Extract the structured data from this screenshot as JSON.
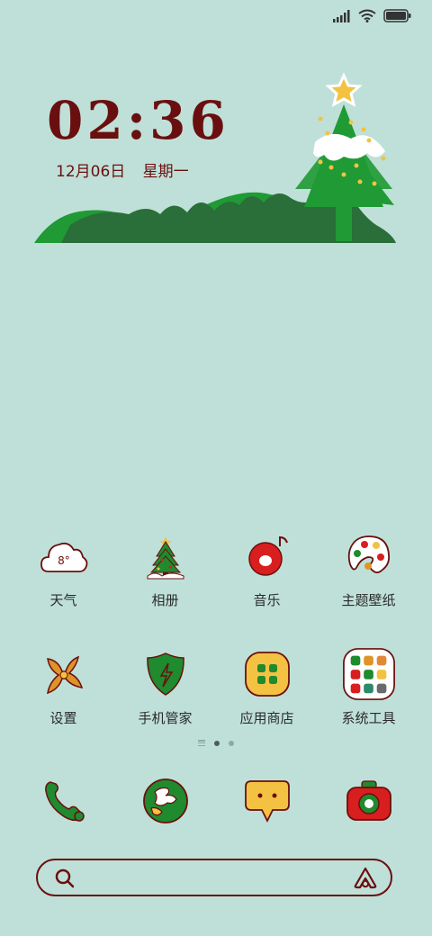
{
  "status_bar": {
    "icons": [
      "signal-icon",
      "wifi-icon",
      "battery-icon"
    ]
  },
  "clock": {
    "time": "02:36",
    "date": "12月06日",
    "weekday": "星期一"
  },
  "apps": [
    {
      "label": "天气",
      "icon": "weather-cloud-icon",
      "temperature": "8°"
    },
    {
      "label": "相册",
      "icon": "christmas-tree-icon"
    },
    {
      "label": "音乐",
      "icon": "music-note-icon"
    },
    {
      "label": "主题壁纸",
      "icon": "paint-palette-icon"
    },
    {
      "label": "设置",
      "icon": "settings-icon"
    },
    {
      "label": "手机管家",
      "icon": "shield-icon"
    },
    {
      "label": "应用商店",
      "icon": "app-store-icon"
    },
    {
      "label": "系统工具",
      "icon": "folder-icon"
    }
  ],
  "page_indicator": {
    "pages": 2,
    "active": 0
  },
  "dock": [
    {
      "name": "phone",
      "icon": "phone-icon"
    },
    {
      "name": "browser",
      "icon": "globe-icon"
    },
    {
      "name": "messages",
      "icon": "chat-bubble-icon"
    },
    {
      "name": "camera",
      "icon": "camera-icon"
    }
  ],
  "search": {
    "placeholder": ""
  },
  "colors": {
    "background": "#bfe0d8",
    "clock": "#6a0f0f",
    "green": "#1f8a2e",
    "dark_green": "#266b38",
    "red": "#d81e1e",
    "yellow": "#f3c242"
  }
}
